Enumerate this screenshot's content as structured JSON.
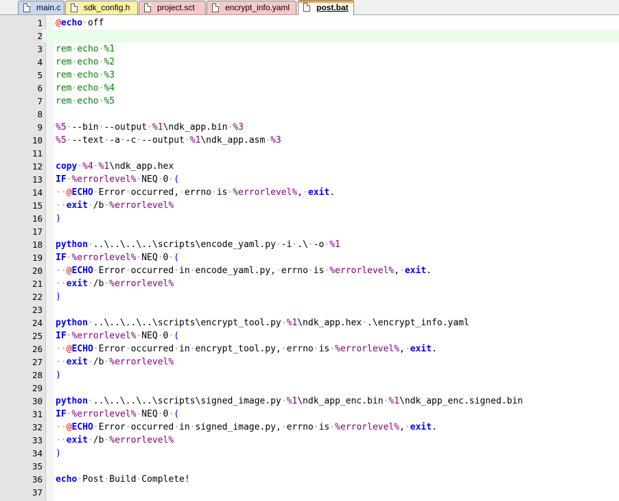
{
  "tabs": [
    {
      "label": "main.c",
      "color": "#c6d9f1",
      "active": false
    },
    {
      "label": "sdk_config.h",
      "color": "#fdf2a3",
      "active": false
    },
    {
      "label": "project.sct",
      "color": "#f8c8c8",
      "active": false
    },
    {
      "label": "encrypt_info.yaml",
      "color": "#f8c8c8",
      "active": false
    },
    {
      "label": "post.bat",
      "color": "#ffffff",
      "active": true
    }
  ],
  "editor": {
    "current_line": 2,
    "lines": [
      {
        "n": "1",
        "t": "@echo off"
      },
      {
        "n": "2",
        "t": ""
      },
      {
        "n": "3",
        "t": "rem echo %1"
      },
      {
        "n": "4",
        "t": "rem echo %2"
      },
      {
        "n": "5",
        "t": "rem echo %3"
      },
      {
        "n": "6",
        "t": "rem echo %4"
      },
      {
        "n": "7",
        "t": "rem echo %5"
      },
      {
        "n": "8",
        "t": ""
      },
      {
        "n": "9",
        "t": "%5 --bin --output %1\\ndk_app.bin %3"
      },
      {
        "n": "10",
        "t": "%5 --text -a -c --output %1\\ndk_app.asm %3"
      },
      {
        "n": "11",
        "t": ""
      },
      {
        "n": "12",
        "t": "copy %4 %1\\ndk_app.hex"
      },
      {
        "n": "13",
        "t": "IF %errorlevel% NEQ 0 ("
      },
      {
        "n": "14",
        "t": "  @ECHO Error occurred, errno is %errorlevel%, exit."
      },
      {
        "n": "15",
        "t": "  exit /b %errorlevel%"
      },
      {
        "n": "16",
        "t": ")"
      },
      {
        "n": "17",
        "t": ""
      },
      {
        "n": "18",
        "t": "python ..\\..\\..\\..\\scripts\\encode_yaml.py -i .\\ -o %1"
      },
      {
        "n": "19",
        "t": "IF %errorlevel% NEQ 0 ("
      },
      {
        "n": "20",
        "t": "  @ECHO Error occurred in encode_yaml.py, errno is %errorlevel%, exit."
      },
      {
        "n": "21",
        "t": "  exit /b %errorlevel%"
      },
      {
        "n": "22",
        "t": ")"
      },
      {
        "n": "23",
        "t": ""
      },
      {
        "n": "24",
        "t": "python ..\\..\\..\\..\\scripts\\encrypt_tool.py %1\\ndk_app.hex .\\encrypt_info.yaml"
      },
      {
        "n": "25",
        "t": "IF %errorlevel% NEQ 0 ("
      },
      {
        "n": "26",
        "t": "  @ECHO Error occurred in encrypt_tool.py, errno is %errorlevel%, exit."
      },
      {
        "n": "27",
        "t": "  exit /b %errorlevel%"
      },
      {
        "n": "28",
        "t": ")"
      },
      {
        "n": "29",
        "t": ""
      },
      {
        "n": "30",
        "t": "python ..\\..\\..\\..\\scripts\\signed_image.py %1\\ndk_app_enc.bin %1\\ndk_app_enc.signed.bin"
      },
      {
        "n": "31",
        "t": "IF %errorlevel% NEQ 0 ("
      },
      {
        "n": "32",
        "t": "  @ECHO Error occurred in signed_image.py, errno is %errorlevel%, exit."
      },
      {
        "n": "33",
        "t": "  exit /b %errorlevel%"
      },
      {
        "n": "34",
        "t": ")"
      },
      {
        "n": "35",
        "t": ""
      },
      {
        "n": "36",
        "t": "echo Post Build Complete!"
      },
      {
        "n": "37",
        "t": ""
      }
    ]
  }
}
